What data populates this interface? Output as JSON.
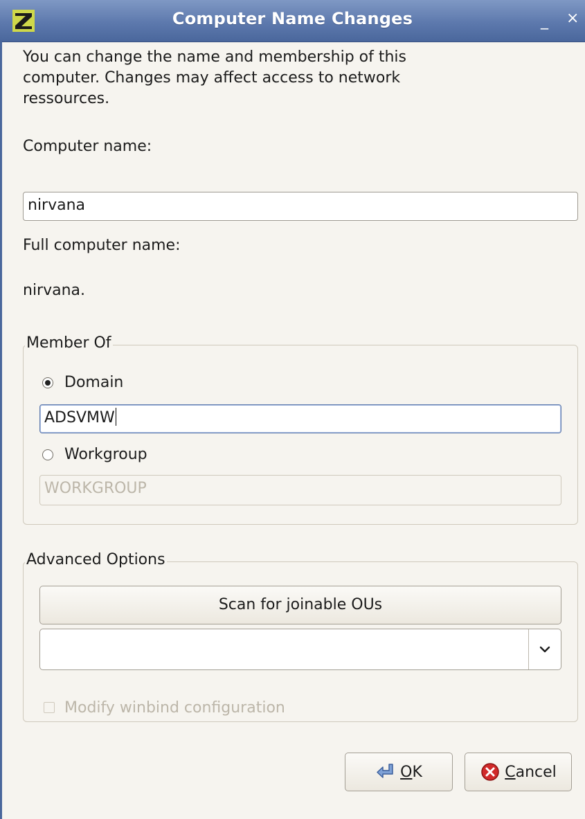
{
  "window": {
    "title": "Computer Name Changes",
    "minimize_glyph": "_",
    "close_glyph": "×",
    "app_icon": "zen-logo-icon"
  },
  "intro": "You can change the name and membership of this\ncomputer. Changes may affect access to network\nressources.",
  "computer_name": {
    "label": "Computer name:",
    "value": "nirvana"
  },
  "full_computer_name": {
    "label": "Full computer name:",
    "value": "nirvana."
  },
  "member_of": {
    "legend": "Member Of",
    "domain": {
      "label": "Domain",
      "selected": true,
      "value": "ADSVMW"
    },
    "workgroup": {
      "label": "Workgroup",
      "selected": false,
      "value": "WORKGROUP"
    }
  },
  "advanced_options": {
    "legend": "Advanced Options",
    "scan_button": "Scan for joinable OUs",
    "ou_combo_value": "",
    "winbind_checkbox": {
      "label": "Modify winbind configuration",
      "checked": false,
      "enabled": false
    }
  },
  "buttons": {
    "ok": {
      "mnemonic": "O",
      "rest": "K",
      "icon": "apply-arrow-icon"
    },
    "cancel": {
      "mnemonic": "C",
      "rest": "ancel",
      "icon": "cancel-icon"
    }
  },
  "colors": {
    "titlebar": "#5d79ad",
    "background": "#f6f4ef",
    "focus_border": "#5d79ad",
    "cancel_icon": "#d12a2a"
  }
}
